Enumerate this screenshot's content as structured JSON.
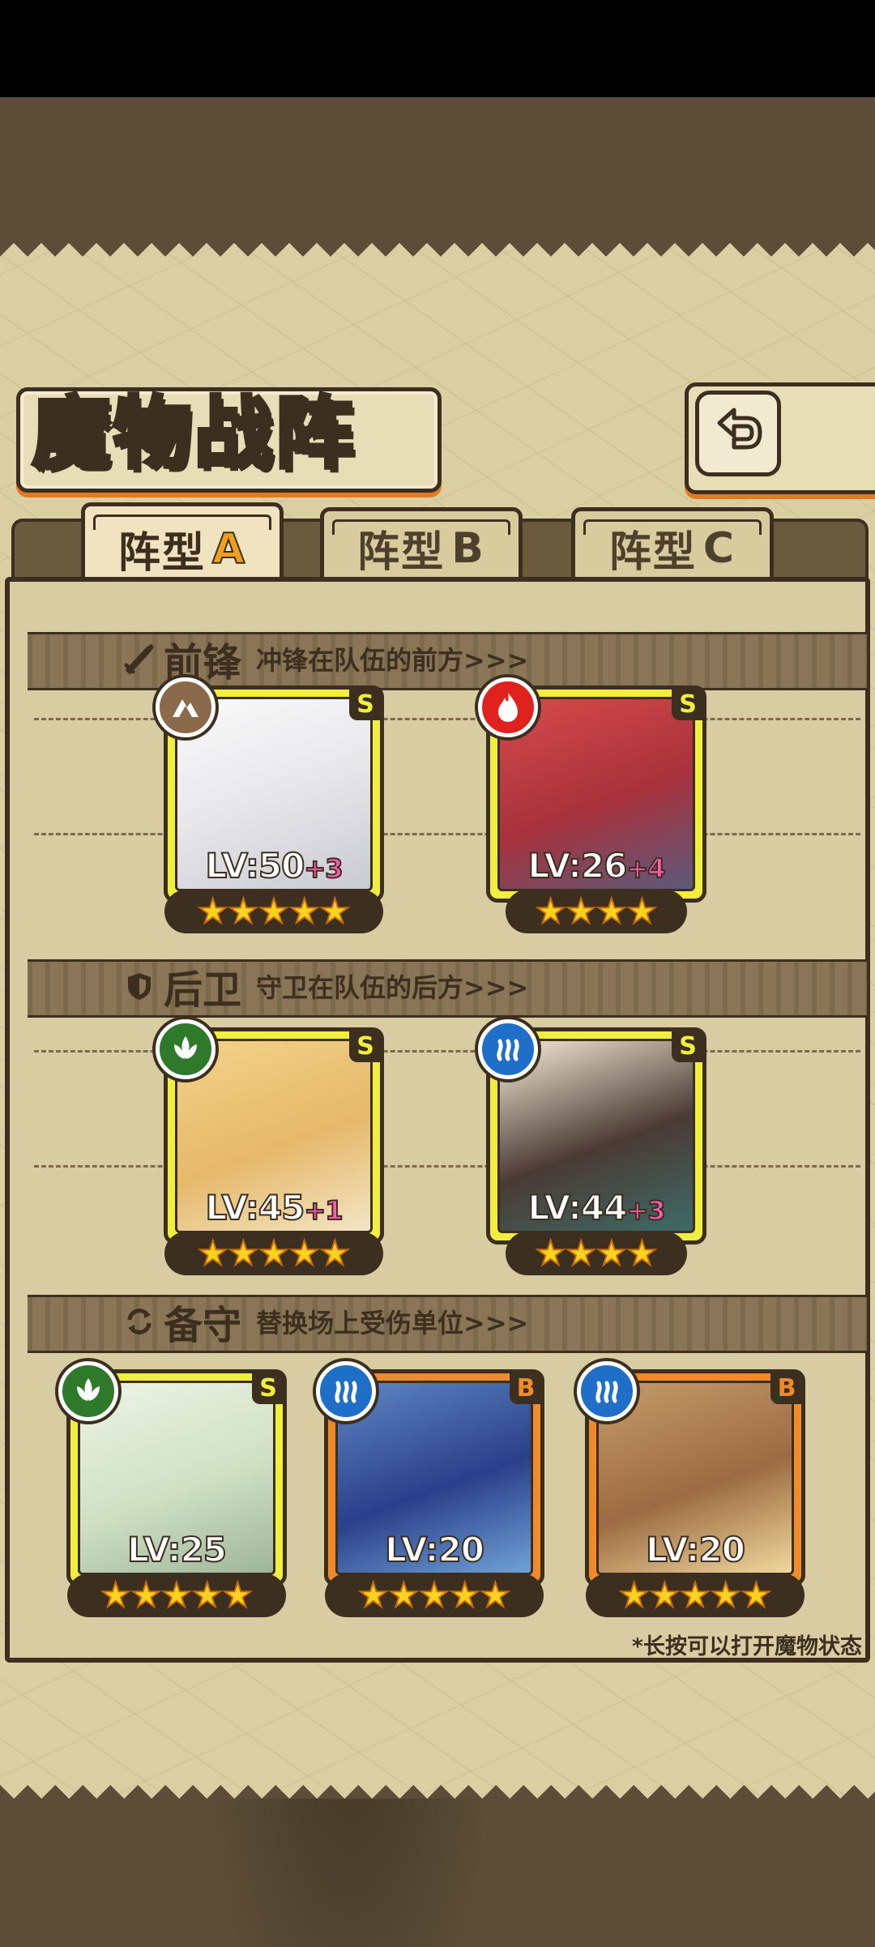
{
  "title": "魔物战阵",
  "tabs": [
    {
      "label": "阵型",
      "letter": "A",
      "active": true
    },
    {
      "label": "阵型",
      "letter": "B",
      "active": false
    },
    {
      "label": "阵型",
      "letter": "C",
      "active": false
    }
  ],
  "sections": {
    "front": {
      "name": "前锋",
      "desc": "冲锋在队伍的前方>>>",
      "icon": "sword-icon"
    },
    "rear": {
      "name": "后卫",
      "desc": "守卫在队伍的后方>>>",
      "icon": "shield-icon"
    },
    "reserve": {
      "name": "备守",
      "desc": "替换场上受伤单位>>>",
      "icon": "swap-icon"
    }
  },
  "units": [
    {
      "rank": "S",
      "element": "earth-icon",
      "level": "LV:50",
      "bonus": "+3",
      "stars": 5
    },
    {
      "rank": "S",
      "element": "fire-icon",
      "level": "LV:26",
      "bonus": "+4",
      "stars": 4
    },
    {
      "rank": "S",
      "element": "leaf-icon",
      "level": "LV:45",
      "bonus": "+1",
      "stars": 5
    },
    {
      "rank": "S",
      "element": "water-icon",
      "level": "LV:44",
      "bonus": "+3",
      "stars": 4
    },
    {
      "rank": "S",
      "element": "leaf-icon",
      "level": "LV:25",
      "bonus": "",
      "stars": 5
    },
    {
      "rank": "B",
      "element": "water-icon",
      "level": "LV:20",
      "bonus": "",
      "stars": 5
    },
    {
      "rank": "B",
      "element": "water-icon",
      "level": "LV:20",
      "bonus": "",
      "stars": 5
    }
  ],
  "hint": "*长按可以打开魔物状态",
  "colors": {
    "accent": "#e07b24",
    "rank_s": "#f0ef40",
    "rank_b": "#f08a2a",
    "star": "#ffd21e",
    "plus": "#ff5ab4"
  }
}
